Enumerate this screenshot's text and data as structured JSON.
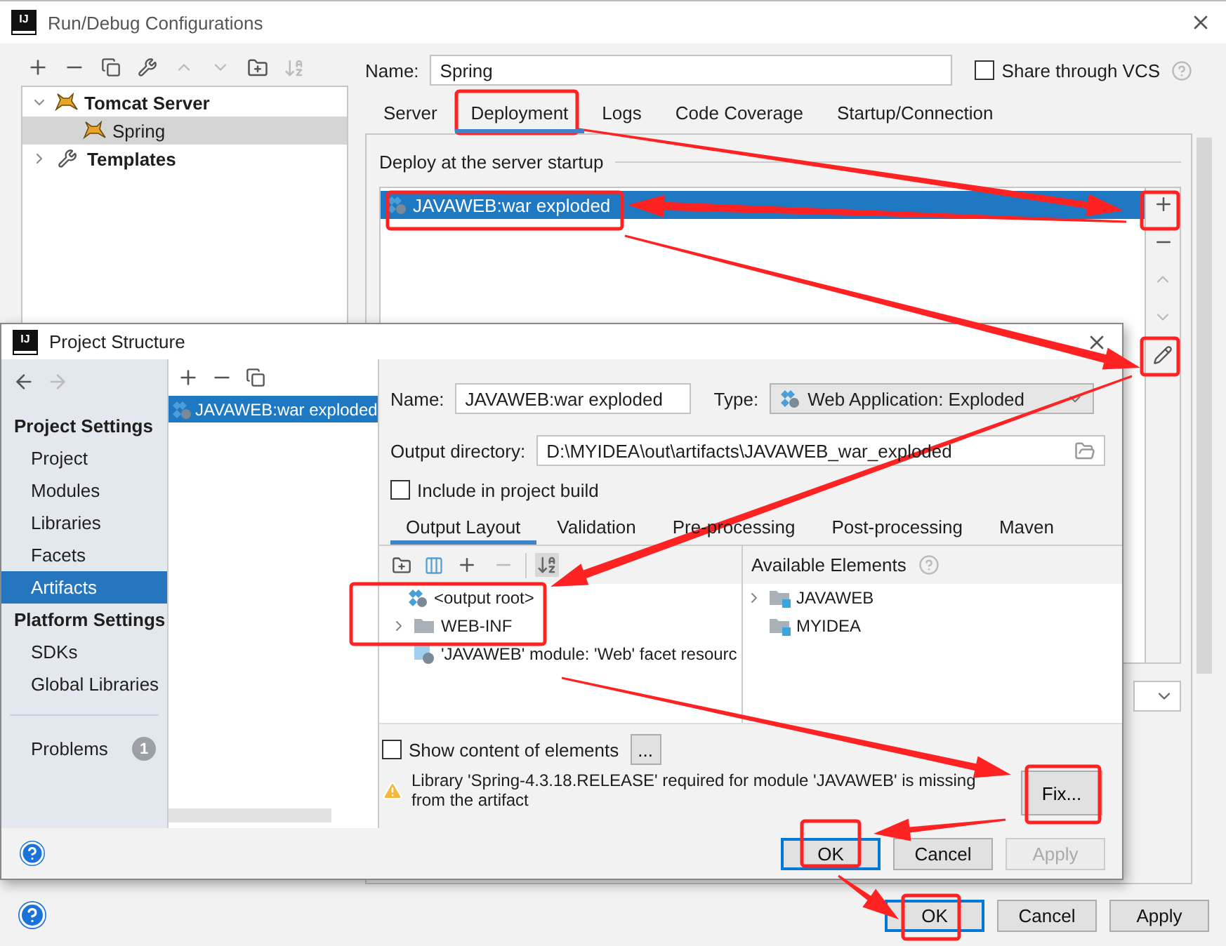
{
  "run_debug": {
    "app_icon": "IJ",
    "title": "Run/Debug Configurations",
    "tree": [
      {
        "label": "Tomcat Server",
        "expanded": true,
        "selected": false,
        "children": [
          {
            "label": "Spring",
            "selected": true
          }
        ]
      },
      {
        "label": "Templates",
        "expanded": false,
        "selected": false
      }
    ],
    "name_label": "Name:",
    "name_value": "Spring",
    "share": {
      "label": "Share through VCS",
      "checked": false
    },
    "tabs": [
      {
        "label": "Server",
        "selected": false
      },
      {
        "label": "Deployment",
        "selected": true
      },
      {
        "label": "Logs",
        "selected": false
      },
      {
        "label": "Code Coverage",
        "selected": false
      },
      {
        "label": "Startup/Connection",
        "selected": false
      }
    ],
    "section_title": "Deploy at the server startup",
    "deploy_items": [
      {
        "label": "JAVAWEB:war exploded",
        "selected": true
      }
    ],
    "buttons": [
      {
        "label": "OK",
        "default": true
      },
      {
        "label": "Cancel",
        "default": false
      },
      {
        "label": "Apply",
        "default": false
      }
    ]
  },
  "project_structure": {
    "app_icon": "IJ",
    "title": "Project Structure",
    "sidebar": [
      {
        "heading": "Project Settings",
        "items": [
          {
            "label": "Project",
            "selected": false
          },
          {
            "label": "Modules",
            "selected": false
          },
          {
            "label": "Libraries",
            "selected": false
          },
          {
            "label": "Facets",
            "selected": false
          },
          {
            "label": "Artifacts",
            "selected": true
          }
        ]
      },
      {
        "heading": "Platform Settings",
        "items": [
          {
            "label": "SDKs",
            "selected": false
          },
          {
            "label": "Global Libraries",
            "selected": false
          }
        ]
      }
    ],
    "problems": {
      "label": "Problems",
      "count": "1"
    },
    "artifacts": [
      {
        "label": "JAVAWEB:war exploded",
        "selected": true
      }
    ],
    "name_label": "Name:",
    "name_value": "JAVAWEB:war exploded",
    "type_label": "Type:",
    "type_value": "Web Application: Exploded",
    "output_label": "Output directory:",
    "output_value": "D:\\MYIDEA\\out\\artifacts\\JAVAWEB_war_exploded",
    "include": {
      "label": "Include in project build",
      "checked": false
    },
    "tabs": [
      {
        "label": "Output Layout",
        "selected": true
      },
      {
        "label": "Validation",
        "selected": false
      },
      {
        "label": "Pre-processing",
        "selected": false
      },
      {
        "label": "Post-processing",
        "selected": false
      },
      {
        "label": "Maven",
        "selected": false
      }
    ],
    "layout_tree": [
      {
        "label": "<output root>",
        "kind": "root",
        "children": [
          {
            "label": "WEB-INF",
            "kind": "folder",
            "expanded": false
          },
          {
            "label": "'JAVAWEB' module: 'Web' facet resourc",
            "kind": "module"
          }
        ]
      }
    ],
    "available_title": "Available Elements",
    "available": [
      {
        "label": "JAVAWEB",
        "expanded": false
      },
      {
        "label": "MYIDEA"
      }
    ],
    "show_content": {
      "label": "Show content of elements",
      "checked": false
    },
    "more_button": "...",
    "warning": "Library 'Spring-4.3.18.RELEASE' required for module 'JAVAWEB' is missing from the artifact",
    "fix_button": "Fix...",
    "buttons": [
      {
        "label": "OK",
        "default": true,
        "disabled": false
      },
      {
        "label": "Cancel",
        "default": false,
        "disabled": false
      },
      {
        "label": "Apply",
        "default": false,
        "disabled": true
      }
    ]
  }
}
